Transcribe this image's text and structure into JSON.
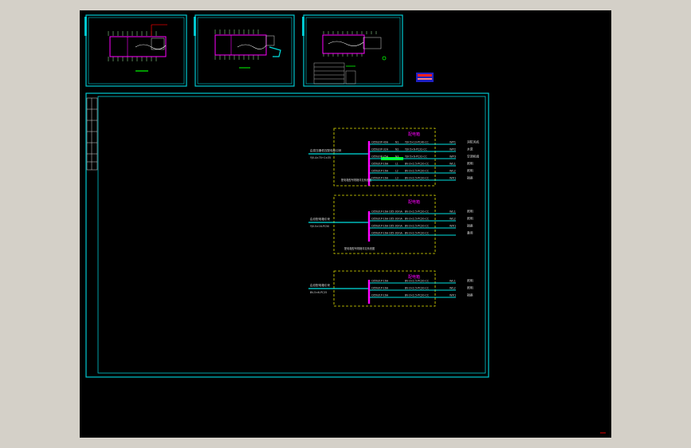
{
  "colors": {
    "window_bg": "#d4d0c8",
    "canvas_bg": "#000000",
    "frame": "#00c8d0",
    "panel_border": "#e0e000",
    "busbar": "#ff00ff",
    "feeder": "#00e0e0",
    "highlight_green": "#00ff00",
    "text": "#d8d8d8",
    "accent_red": "#e00000"
  },
  "panels": [
    {
      "title": "配电箱",
      "incoming_label": "由变压器低压配电柜引来",
      "incoming_cable": "YJV-4×70+1×35",
      "bottom_note": "配电箱型号规格详见系统图",
      "feeders": [
        {
          "breaker": "C65N/3P-40A",
          "cable": "YJV-5×10-PC40-CC",
          "tag": "N1",
          "code": "WP1",
          "load": "消防风机"
        },
        {
          "breaker": "C65N/3P-32A",
          "cable": "YJV-5×6-PC32-CC",
          "tag": "N2",
          "code": "WP2",
          "load": "水泵"
        },
        {
          "breaker": "C65N/3P-25A",
          "cable": "YJV-5×6-PC32-CC",
          "tag": "N3",
          "code": "WP3",
          "load": "空调机组"
        },
        {
          "breaker": "C65N/1P-16A",
          "cable": "BV-3×2.5-PC20-CC",
          "tag": "L1",
          "code": "WL1",
          "load": "照明"
        },
        {
          "breaker": "C65N/1P-16A",
          "cable": "BV-3×2.5-PC20-CC",
          "tag": "L2",
          "code": "WL2",
          "load": "照明"
        },
        {
          "breaker": "C65N/1P-16A",
          "cable": "BV-3×2.5-PC20-CC",
          "tag": "L3",
          "code": "WX1",
          "load": "插座"
        }
      ]
    },
    {
      "title": "配电箱",
      "incoming_label": "由总配电箱引来",
      "incoming_cable": "YJV-5×16-PC50",
      "bottom_note": "配电箱型号规格详见系统图",
      "feeders": [
        {
          "breaker": "C65N/1P-16A C65-30mA",
          "cable": "BV-3×2.5-PC20-CC",
          "tag": "",
          "code": "WL1",
          "load": "照明"
        },
        {
          "breaker": "C65N/1P-16A C65-30mA",
          "cable": "BV-3×2.5-PC20-CC",
          "tag": "",
          "code": "WL2",
          "load": "照明"
        },
        {
          "breaker": "C65N/1P-16A C65-30mA",
          "cable": "BV-3×2.5-PC20-CC",
          "tag": "",
          "code": "WX1",
          "load": "插座"
        },
        {
          "breaker": "C65N/1P-16A C65-30mA",
          "cable": "BV-3×2.5-PC20-CC",
          "tag": "",
          "code": "",
          "load": "备用"
        }
      ]
    },
    {
      "title": "配电箱",
      "incoming_label": "由总配电箱引来",
      "incoming_cable": "BV-5×6-PC25",
      "bottom_note": "",
      "feeders": [
        {
          "breaker": "C65N/1P-16A",
          "cable": "BV-3×2.5-PC20-CC",
          "tag": "",
          "code": "WL1",
          "load": "照明"
        },
        {
          "breaker": "C65N/1P-16A",
          "cable": "BV-3×2.5-PC20-CC",
          "tag": "",
          "code": "WL2",
          "load": "照明"
        },
        {
          "breaker": "C65N/1P-16A",
          "cable": "BV-3×2.5-PC20-CC",
          "tag": "",
          "code": "WX1",
          "load": "插座"
        }
      ]
    }
  ]
}
